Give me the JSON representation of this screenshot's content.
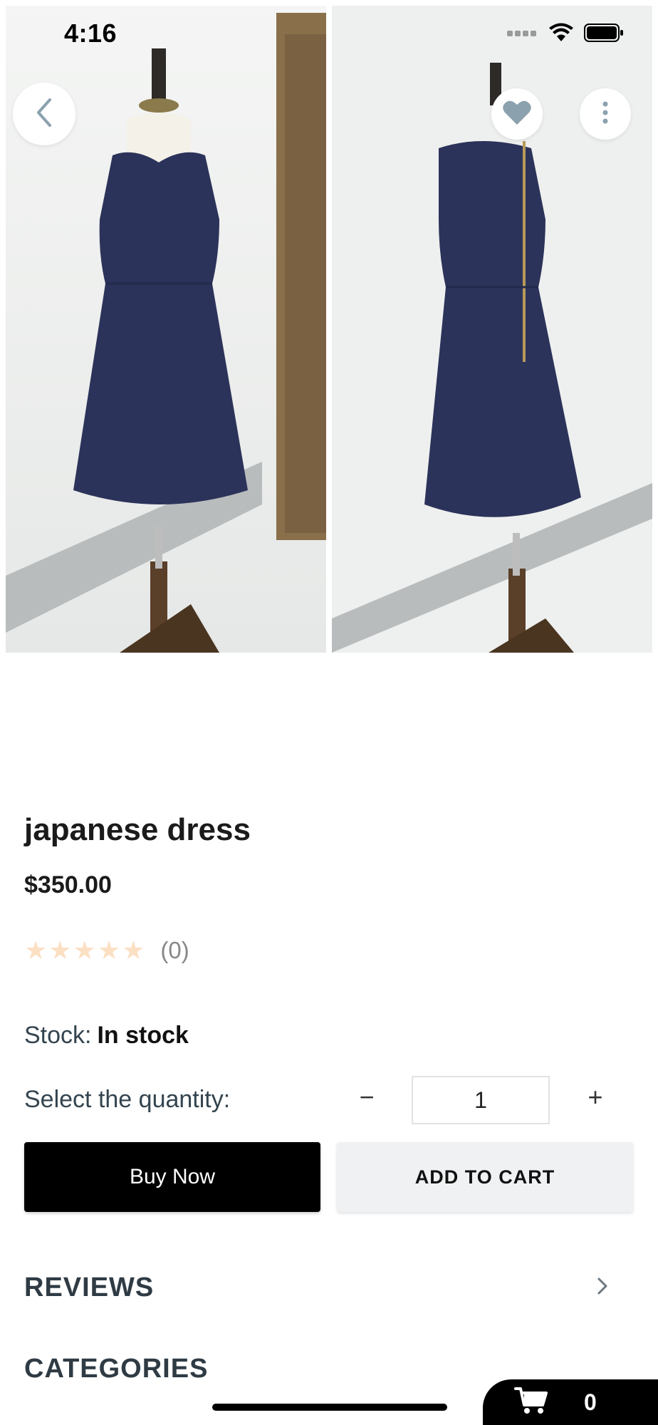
{
  "status_bar": {
    "time": "4:16"
  },
  "gallery": {
    "images": [
      "dress-front-photo",
      "dress-back-photo"
    ],
    "colors": {
      "dress": "#2c335a",
      "wall": "#eef0ef",
      "door": "#8a6f4b"
    }
  },
  "product": {
    "title": "japanese dress",
    "price": "$350.00",
    "rating": {
      "stars": 5,
      "filled": 0,
      "count_label": "(0)"
    },
    "stock": {
      "label": "Stock:",
      "value": "In stock"
    },
    "quantity": {
      "label": "Select the quantity:",
      "minus": "−",
      "value": "1",
      "plus": "+"
    }
  },
  "actions": {
    "buy_now": "Buy Now",
    "add_to_cart": "ADD TO CART"
  },
  "sections": {
    "reviews": "REVIEWS",
    "categories": "CATEGORIES"
  },
  "cart": {
    "count": "0"
  },
  "theme": {
    "star_color": "#fbe0c4",
    "heart_color": "#8ba1ae",
    "primary": "#000000"
  }
}
